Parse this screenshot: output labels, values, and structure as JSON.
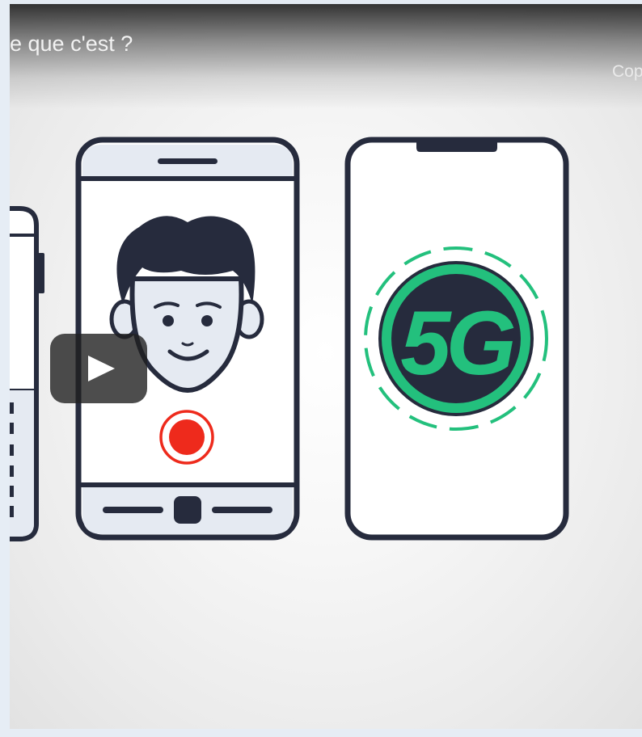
{
  "video": {
    "title": "e que c'est ?",
    "copy_link_label": "Cop",
    "badge_text": "5G"
  },
  "icons": {
    "play": "play-icon",
    "record": "record-icon",
    "face": "face-icon",
    "phone": "smartphone-icon"
  },
  "colors": {
    "outline": "#262b3d",
    "accent_green": "#23c07d",
    "record_red": "#ee2a1c",
    "screen_fill": "#e5eaf2"
  }
}
